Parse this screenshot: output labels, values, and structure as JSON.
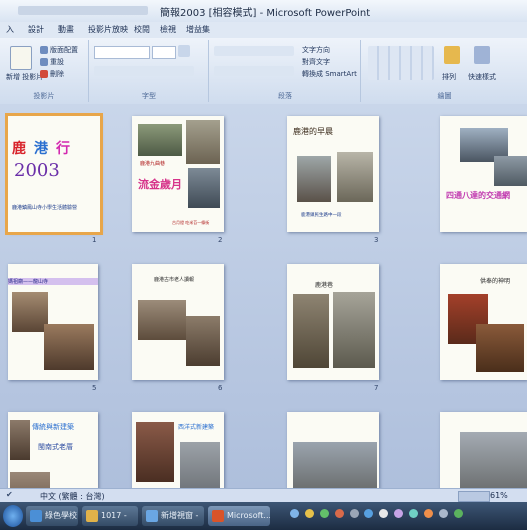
{
  "window": {
    "title": "簡報2003 [相容模式] - Microsoft PowerPoint"
  },
  "menu": [
    "入",
    "設計",
    "動畫",
    "投影片放映",
    "校閱",
    "檢視",
    "增益集"
  ],
  "ribbon": {
    "groups": [
      "投影片",
      "字型",
      "段落",
      "繪圖"
    ],
    "slides": {
      "new_slide": "新增\n投影片",
      "layout": "版面配置",
      "reset": "重設",
      "delete": "刪除"
    },
    "paragraph": {
      "text_direction": "文字方向",
      "align_text": "對齊文字",
      "smartart": "轉換成 SmartArt"
    },
    "drawing": {
      "arrange": "排列",
      "quick_styles": "快速樣式"
    }
  },
  "slides": [
    {
      "number": "1",
      "title_lines": [
        "鹿",
        "港",
        "行",
        "2003"
      ],
      "caption": "鹿港鎮鳳山寺小學生活體驗營",
      "sub": "",
      "selected": true
    },
    {
      "number": "2",
      "title": "鹿港九曲巷",
      "caption": "流金歲月",
      "sub": "古月燈 吃米苔一條街",
      "selected": false
    },
    {
      "number": "3",
      "title": "鹿港的早晨",
      "caption": "鹿港鎮民生路中一段",
      "sub": "",
      "selected": false
    },
    {
      "number": "4",
      "title": "",
      "caption": "四通八達的交通網",
      "sub": "",
      "selected": false
    },
    {
      "number": "5",
      "title": "媽祖廟——龍山寺",
      "caption": "",
      "sub": "",
      "selected": false
    },
    {
      "number": "6",
      "title": "鹿港古市老人讀報",
      "caption": "",
      "sub": "",
      "selected": false
    },
    {
      "number": "7",
      "title": "鹿港巷",
      "caption": "",
      "sub": "",
      "selected": false
    },
    {
      "number": "8",
      "title": "供奉的神明",
      "caption": "",
      "sub": "",
      "selected": false
    },
    {
      "number": "9",
      "title": "傳統與新建築",
      "caption": "閩南式老厝",
      "sub": "",
      "selected": false
    },
    {
      "number": "10",
      "title": "西洋式新建築",
      "caption": "",
      "sub": "",
      "selected": false
    },
    {
      "number": "11",
      "title": "",
      "caption": "",
      "sub": "",
      "selected": false
    },
    {
      "number": "12",
      "title": "",
      "caption": "",
      "sub": "",
      "selected": false
    }
  ],
  "status": {
    "language": "中文 (繁體 : 台灣)",
    "zoom": "61%"
  },
  "taskbar": [
    {
      "label": "綠色學校 -",
      "color": "#4b8fd6"
    },
    {
      "label": "1017 -",
      "color": "#e0b24a"
    },
    {
      "label": "新增視窗 -",
      "color": "#6aa6e3"
    },
    {
      "label": "Microsoft...",
      "color": "#d9542a"
    }
  ]
}
